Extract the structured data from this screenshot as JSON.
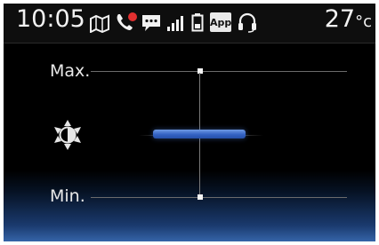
{
  "status_bar": {
    "time": "10:05",
    "temperature": "27",
    "temperature_unit": "°c",
    "app_badge": "App",
    "icons": [
      "navigation-icon",
      "phone-missed-call-icon",
      "message-icon",
      "signal-strength-icon",
      "battery-icon",
      "app-icon",
      "headset-icon"
    ],
    "colors": {
      "missed_call_dot": "#e23030",
      "text": "#f2f2f2"
    }
  },
  "brightness_setting": {
    "max_label": "Max.",
    "min_label": "Min.",
    "icon": "brightness-icon",
    "level_fraction": 0.5,
    "bar_color": "#3a6ccc"
  }
}
